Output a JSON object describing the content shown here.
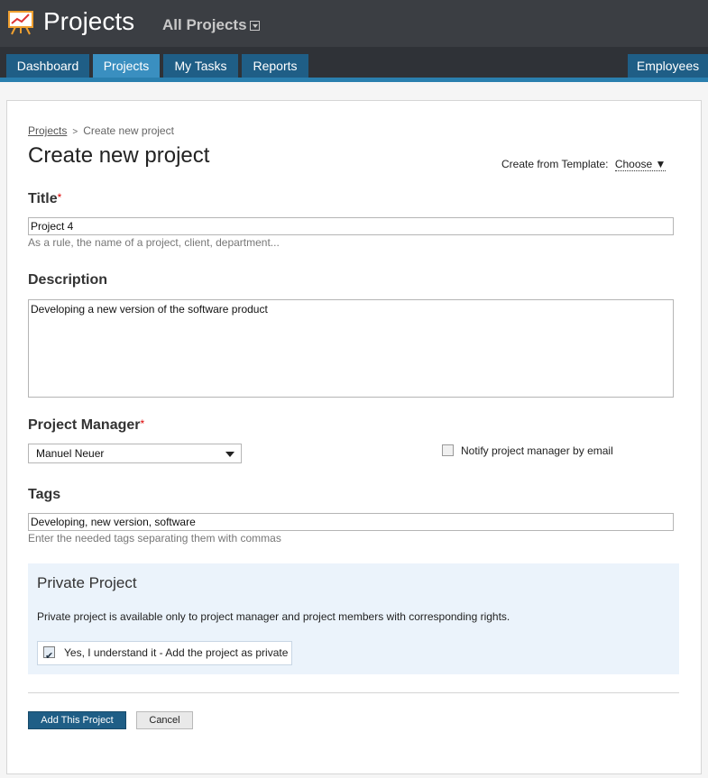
{
  "header": {
    "app_title": "Projects",
    "project_selector": "All Projects",
    "logo_icon": "easel-chart-icon"
  },
  "nav": {
    "tabs": [
      {
        "label": "Dashboard",
        "active": false
      },
      {
        "label": "Projects",
        "active": true
      },
      {
        "label": "My Tasks",
        "active": false
      },
      {
        "label": "Reports",
        "active": false
      }
    ],
    "right_tab": "Employees"
  },
  "breadcrumb": {
    "parent": "Projects",
    "separator": ">",
    "current": "Create new project"
  },
  "page": {
    "title": "Create new project",
    "template_label": "Create from Template:",
    "template_choice": "Choose ▼"
  },
  "form": {
    "title": {
      "label": "Title",
      "required_mark": "*",
      "value": "Project 4",
      "hint": "As a rule, the name of a project, client, department..."
    },
    "description": {
      "label": "Description",
      "value": "Developing a new version of the software product"
    },
    "manager": {
      "label": "Project Manager",
      "required_mark": "*",
      "value": "Manuel Neuer",
      "notify_label": "Notify project manager by email",
      "notify_checked": false
    },
    "tags": {
      "label": "Tags",
      "value": "Developing, new version, software",
      "hint": "Enter the needed tags separating them with commas"
    },
    "private": {
      "title": "Private Project",
      "text": "Private project is available only to project manager and project members with corresponding rights.",
      "check_label": "Yes, I understand it - Add the project as private",
      "checked": true
    }
  },
  "actions": {
    "submit": "Add This Project",
    "cancel": "Cancel"
  },
  "colors": {
    "header_bg": "#3b3e43",
    "tab_bg": "#1f5e86",
    "tab_active_bg": "#3a8fc0",
    "accent_strip": "#2a7fae",
    "private_bg": "#ebf3fb",
    "required": "#dd0000"
  }
}
